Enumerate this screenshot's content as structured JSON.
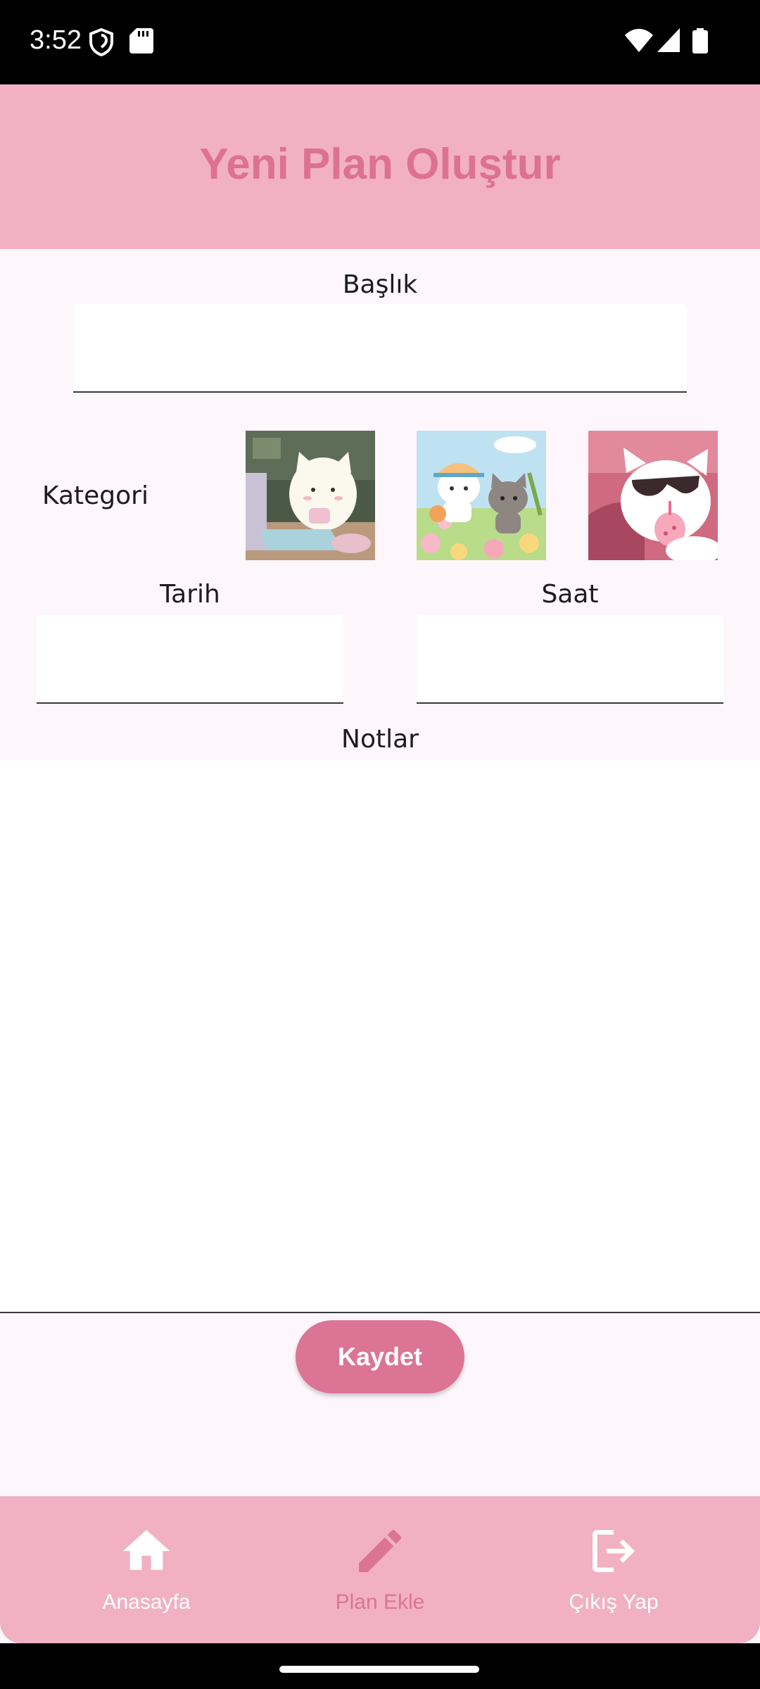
{
  "status_bar": {
    "time": "3:52"
  },
  "app_bar": {
    "title": "Yeni Plan Oluştur"
  },
  "form": {
    "title_label": "Başlık",
    "title_value": "",
    "category_label": "Kategori",
    "categories": [
      {
        "icon": "cat-at-computer-image"
      },
      {
        "icon": "cats-in-flower-field-image"
      },
      {
        "icon": "cat-with-sunglasses-image"
      }
    ],
    "date_label": "Tarih",
    "date_value": "",
    "time_label": "Saat",
    "time_value": "",
    "notes_label": "Notlar",
    "notes_value": "",
    "save_label": "Kaydet"
  },
  "bottom_nav": {
    "items": [
      {
        "label": "Anasayfa",
        "icon": "home-icon",
        "active": false
      },
      {
        "label": "Plan Ekle",
        "icon": "pencil-icon",
        "active": true
      },
      {
        "label": "Çıkış Yap",
        "icon": "logout-icon",
        "active": false
      }
    ]
  },
  "colors": {
    "app_bar": "#f1b1c3",
    "title": "#dd7194",
    "background": "#fdf6fb",
    "button": "#dc7495",
    "nav_active": "#dc7495",
    "nav_inactive": "#ffffff"
  }
}
